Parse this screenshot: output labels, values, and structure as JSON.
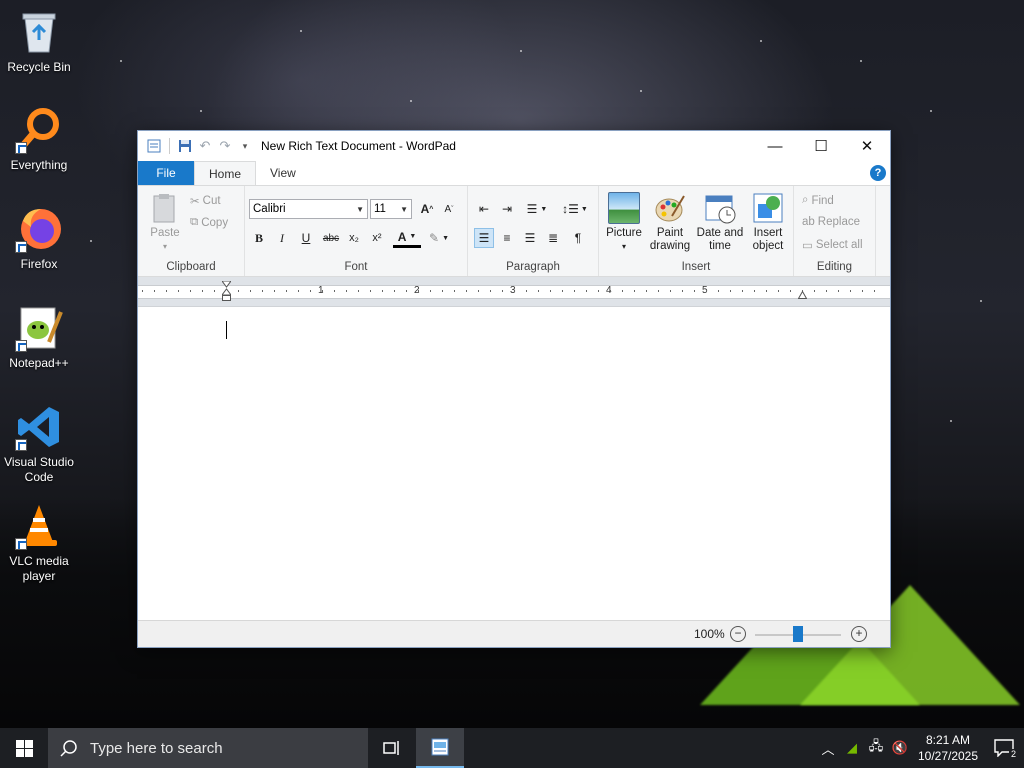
{
  "desktop": {
    "icons": [
      {
        "label": "Recycle Bin"
      },
      {
        "label": "Everything"
      },
      {
        "label": "Firefox"
      },
      {
        "label": "Notepad++"
      },
      {
        "label": "Visual Studio Code"
      },
      {
        "label": "VLC media player"
      }
    ]
  },
  "window": {
    "title": "New Rich Text Document - WordPad",
    "tabs": {
      "file": "File",
      "home": "Home",
      "view": "View"
    },
    "help": "?",
    "ribbon": {
      "clipboard": {
        "label": "Clipboard",
        "paste": "Paste",
        "cut": "Cut",
        "copy": "Copy"
      },
      "font": {
        "label": "Font",
        "family": "Calibri",
        "size": "11",
        "bold": "B",
        "italic": "I",
        "underline": "U",
        "strike": "abc",
        "subscript": "x₂",
        "superscript": "x²",
        "color": "A"
      },
      "paragraph": {
        "label": "Paragraph"
      },
      "insert": {
        "label": "Insert",
        "picture": "Picture",
        "paint_drawing": "Paint drawing",
        "date_time": "Date and time",
        "insert_object": "Insert object"
      },
      "editing": {
        "label": "Editing",
        "find": "Find",
        "replace": "Replace",
        "select_all": "Select all"
      }
    },
    "ruler": {
      "numbers": [
        "1",
        "2",
        "3",
        "4",
        "5"
      ]
    },
    "status": {
      "zoom": "100%",
      "zoom_out": "−",
      "zoom_in": "+",
      "zoom_level": 1.0
    }
  },
  "taskbar": {
    "search_placeholder": "Type here to search",
    "clock_time": "8:21 AM",
    "clock_date": "10/27/2025",
    "notification_count": "2"
  }
}
